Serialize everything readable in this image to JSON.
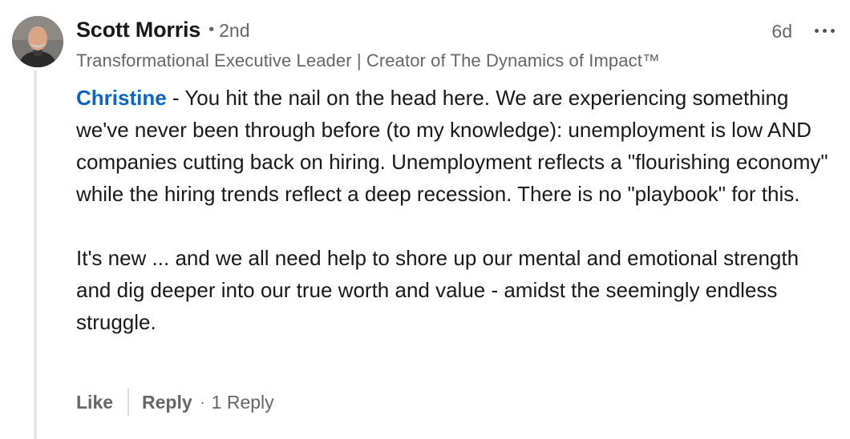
{
  "comment": {
    "author": {
      "name": "Scott Morris",
      "degree": "2nd",
      "headline": "Transformational Executive Leader | Creator of The Dynamics of Impact™"
    },
    "timestamp": "6d",
    "more_icon": "ellipsis-horizontal",
    "mention": "Christine",
    "paragraph_1_rest": " - You hit the nail on the head here. We are experiencing something we've never been through before (to my knowledge): unemployment is low AND companies cutting back on hiring. Unemployment reflects a \"flourishing economy\" while the hiring trends reflect a deep recession. There is no \"playbook\" for this.",
    "paragraph_2": "It's new ... and we all need help to shore up our mental and emotional strength and dig deeper into our true worth and value - amidst the seemingly endless struggle.",
    "actions": {
      "like_label": "Like",
      "reply_label": "Reply",
      "reply_count": "1 Reply"
    }
  },
  "colors": {
    "mention": "#0a66c2",
    "secondary_text": "#666666",
    "primary_text": "#191919",
    "thread_line": "#e9e6df"
  }
}
